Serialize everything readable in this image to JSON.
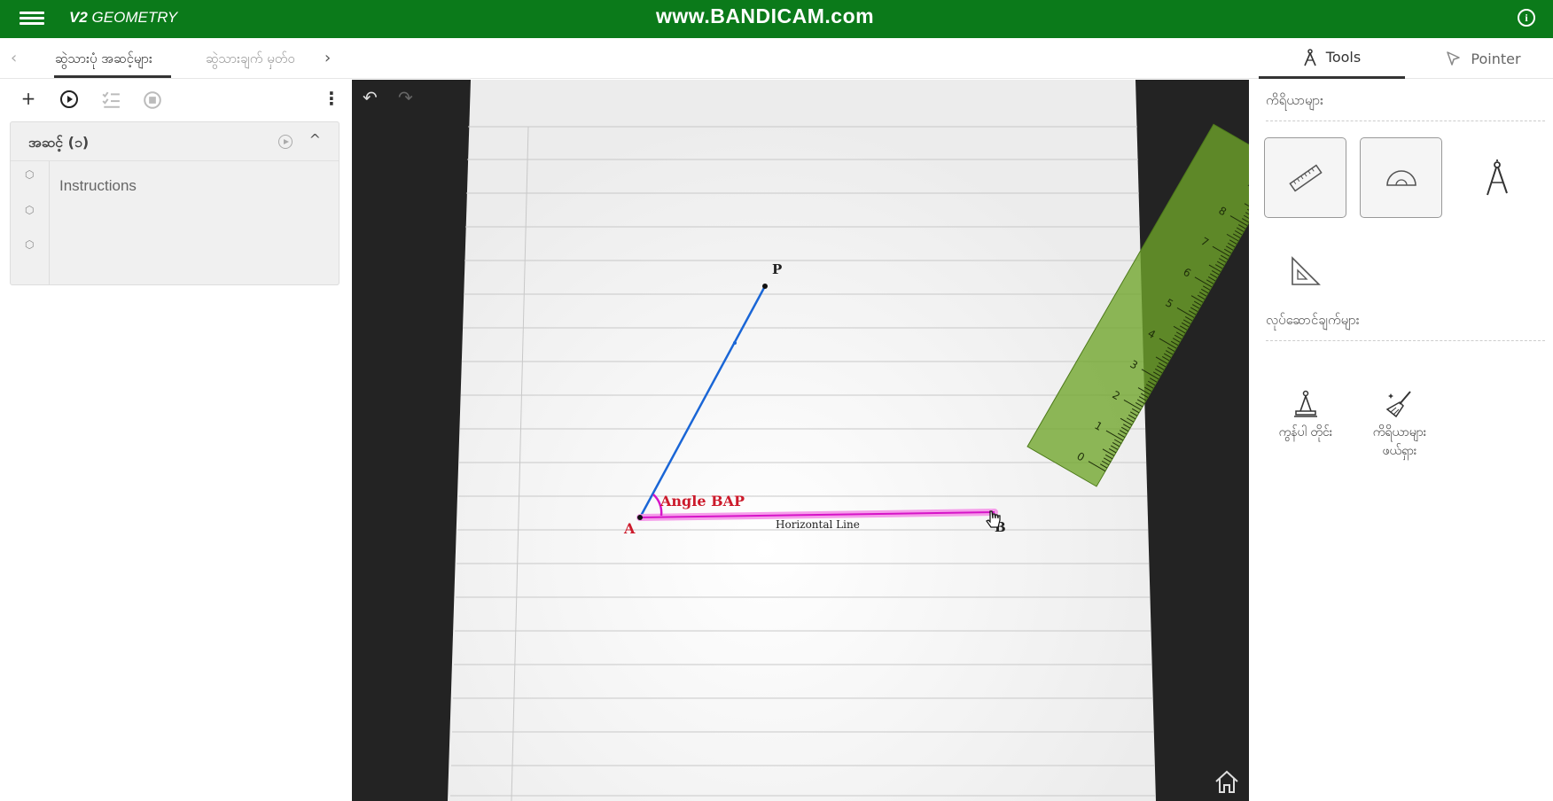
{
  "app": {
    "title_bold": "V2",
    "title_rest": "GEOMETRY",
    "watermark": "www.BANDICAM.com",
    "info_glyph": "i"
  },
  "tabs": {
    "prev": "‹",
    "next": "›",
    "items": [
      {
        "label": "ဆွဲသားပုံ အဆင့်များ",
        "active": true
      },
      {
        "label": "ဆွဲသားချက် မှတ်ဝ",
        "active": false
      }
    ]
  },
  "right_tabs": {
    "tools": "Tools",
    "pointer": "Pointer"
  },
  "left_toolbar": {
    "add": "+",
    "more": "⋮"
  },
  "step": {
    "title": "အဆင့် (၁)",
    "collapse": "^",
    "instructions": "Instructions",
    "cube_glyph": "⬡"
  },
  "canvas": {
    "undo": "↶",
    "redo": "↷",
    "labels": {
      "point_p": "P",
      "point_a": "A",
      "point_b": "B",
      "angle": "Angle BAP",
      "line": "Horizontal Line"
    },
    "ruler_ticks": [
      "0",
      "1",
      "2",
      "3",
      "4",
      "5",
      "6",
      "7",
      "8"
    ],
    "colors": {
      "segment_ap": "#1a66d6",
      "segment_ab": "#e619d6",
      "angle_label": "#cc1a2b",
      "ruler": "#6fa52a"
    }
  },
  "right_panel": {
    "tools_section": "ကိရိယာများ",
    "actions_section": "လုပ်ဆောင်ချက်များ",
    "tools": [
      "ruler-icon",
      "protractor-icon",
      "compass-icon",
      "set-square-icon"
    ],
    "actions": [
      {
        "icon": "construction-icon",
        "label": "ကွန်ပါ တိုင်း"
      },
      {
        "icon": "broom-icon",
        "label": "ကိရိယာများ",
        "label2": "ဖယ်ရှား"
      }
    ]
  }
}
